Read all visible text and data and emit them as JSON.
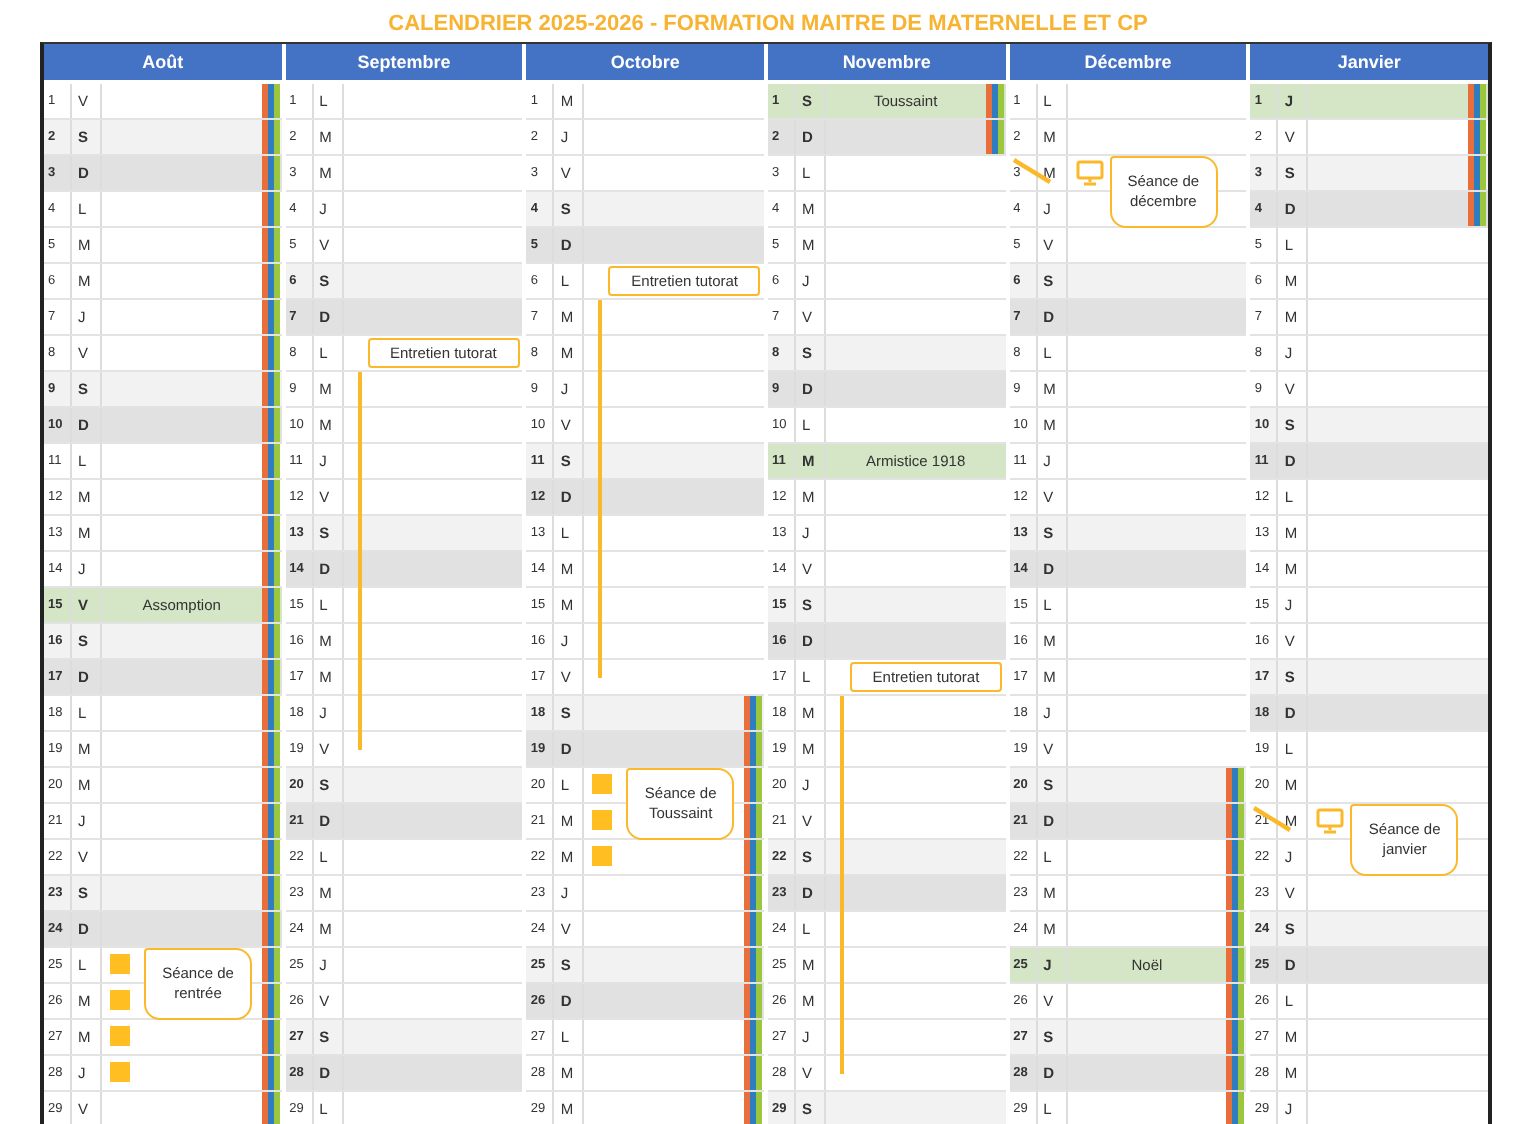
{
  "title": "CALENDRIER 2025-2026 - FORMATION MAITRE DE MATERNELLE ET CP",
  "months": [
    {
      "name": "Août",
      "days": [
        {
          "n": "1",
          "wd": "V",
          "kind": "weekday",
          "vacation": true,
          "line": false
        },
        {
          "n": "2",
          "wd": "S",
          "kind": "saturday",
          "vacation": true,
          "line": false
        },
        {
          "n": "3",
          "wd": "D",
          "kind": "sunday",
          "vacation": true,
          "line": false
        },
        {
          "n": "4",
          "wd": "L",
          "kind": "weekday",
          "vacation": true,
          "line": false
        },
        {
          "n": "5",
          "wd": "M",
          "kind": "weekday",
          "vacation": true,
          "line": false
        },
        {
          "n": "6",
          "wd": "M",
          "kind": "weekday",
          "vacation": true,
          "line": false
        },
        {
          "n": "7",
          "wd": "J",
          "kind": "weekday",
          "vacation": true,
          "line": false
        },
        {
          "n": "8",
          "wd": "V",
          "kind": "weekday",
          "vacation": true,
          "line": false
        },
        {
          "n": "9",
          "wd": "S",
          "kind": "saturday",
          "vacation": true,
          "line": false
        },
        {
          "n": "10",
          "wd": "D",
          "kind": "sunday",
          "vacation": true,
          "line": false
        },
        {
          "n": "11",
          "wd": "L",
          "kind": "weekday",
          "vacation": true,
          "line": false
        },
        {
          "n": "12",
          "wd": "M",
          "kind": "weekday",
          "vacation": true,
          "line": false
        },
        {
          "n": "13",
          "wd": "M",
          "kind": "weekday",
          "vacation": true,
          "line": false
        },
        {
          "n": "14",
          "wd": "J",
          "kind": "weekday",
          "vacation": true,
          "line": false
        },
        {
          "n": "15",
          "wd": "V",
          "kind": "holiday",
          "label": "Assomption",
          "vacation": true,
          "line": false
        },
        {
          "n": "16",
          "wd": "S",
          "kind": "saturday",
          "vacation": true,
          "line": false
        },
        {
          "n": "17",
          "wd": "D",
          "kind": "sunday",
          "vacation": true,
          "line": false
        },
        {
          "n": "18",
          "wd": "L",
          "kind": "weekday",
          "vacation": true,
          "line": false
        },
        {
          "n": "19",
          "wd": "M",
          "kind": "weekday",
          "vacation": true,
          "line": false
        },
        {
          "n": "20",
          "wd": "M",
          "kind": "weekday",
          "vacation": true,
          "line": false
        },
        {
          "n": "21",
          "wd": "J",
          "kind": "weekday",
          "vacation": true,
          "line": false
        },
        {
          "n": "22",
          "wd": "V",
          "kind": "weekday",
          "vacation": true,
          "line": false
        },
        {
          "n": "23",
          "wd": "S",
          "kind": "saturday",
          "vacation": true,
          "line": false
        },
        {
          "n": "24",
          "wd": "D",
          "kind": "sunday",
          "vacation": true,
          "line": false
        },
        {
          "n": "25",
          "wd": "L",
          "kind": "weekday",
          "vacation": true,
          "line": false,
          "marker": {
            "kind": "square"
          },
          "note": {
            "kind": "callout",
            "text": "Séance de rentrée"
          }
        },
        {
          "n": "26",
          "wd": "M",
          "kind": "weekday",
          "vacation": true,
          "line": false,
          "marker": {
            "kind": "square"
          }
        },
        {
          "n": "27",
          "wd": "M",
          "kind": "weekday",
          "vacation": true,
          "line": false,
          "marker": {
            "kind": "square"
          }
        },
        {
          "n": "28",
          "wd": "J",
          "kind": "weekday",
          "vacation": true,
          "line": false,
          "marker": {
            "kind": "square"
          }
        },
        {
          "n": "29",
          "wd": "V",
          "kind": "weekday",
          "vacation": true,
          "line": false
        }
      ]
    },
    {
      "name": "Septembre",
      "days": [
        {
          "n": "1",
          "wd": "L",
          "kind": "weekday",
          "vacation": false,
          "line": false
        },
        {
          "n": "2",
          "wd": "M",
          "kind": "weekday",
          "vacation": false,
          "line": false
        },
        {
          "n": "3",
          "wd": "M",
          "kind": "weekday",
          "vacation": false,
          "line": false
        },
        {
          "n": "4",
          "wd": "J",
          "kind": "weekday",
          "vacation": false,
          "line": false
        },
        {
          "n": "5",
          "wd": "V",
          "kind": "weekday",
          "vacation": false,
          "line": false
        },
        {
          "n": "6",
          "wd": "S",
          "kind": "saturday",
          "vacation": false,
          "line": false
        },
        {
          "n": "7",
          "wd": "D",
          "kind": "sunday",
          "vacation": false,
          "line": false
        },
        {
          "n": "8",
          "wd": "L",
          "kind": "weekday",
          "vacation": false,
          "line": false,
          "note": {
            "kind": "tag",
            "text": "Entretien tutorat"
          }
        },
        {
          "n": "9",
          "wd": "M",
          "kind": "weekday",
          "vacation": false,
          "line": true
        },
        {
          "n": "10",
          "wd": "M",
          "kind": "weekday",
          "vacation": false,
          "line": true
        },
        {
          "n": "11",
          "wd": "J",
          "kind": "weekday",
          "vacation": false,
          "line": true
        },
        {
          "n": "12",
          "wd": "V",
          "kind": "weekday",
          "vacation": false,
          "line": true
        },
        {
          "n": "13",
          "wd": "S",
          "kind": "saturday",
          "vacation": false,
          "line": true
        },
        {
          "n": "14",
          "wd": "D",
          "kind": "sunday",
          "vacation": false,
          "line": true
        },
        {
          "n": "15",
          "wd": "L",
          "kind": "weekday",
          "vacation": false,
          "line": true
        },
        {
          "n": "16",
          "wd": "M",
          "kind": "weekday",
          "vacation": false,
          "line": true
        },
        {
          "n": "17",
          "wd": "M",
          "kind": "weekday",
          "vacation": false,
          "line": true
        },
        {
          "n": "18",
          "wd": "J",
          "kind": "weekday",
          "vacation": false,
          "line": true
        },
        {
          "n": "19",
          "wd": "V",
          "kind": "weekday",
          "vacation": false,
          "line": true
        },
        {
          "n": "20",
          "wd": "S",
          "kind": "saturday",
          "vacation": false,
          "line": false
        },
        {
          "n": "21",
          "wd": "D",
          "kind": "sunday",
          "vacation": false,
          "line": false
        },
        {
          "n": "22",
          "wd": "L",
          "kind": "weekday",
          "vacation": false,
          "line": false
        },
        {
          "n": "23",
          "wd": "M",
          "kind": "weekday",
          "vacation": false,
          "line": false
        },
        {
          "n": "24",
          "wd": "M",
          "kind": "weekday",
          "vacation": false,
          "line": false
        },
        {
          "n": "25",
          "wd": "J",
          "kind": "weekday",
          "vacation": false,
          "line": false
        },
        {
          "n": "26",
          "wd": "V",
          "kind": "weekday",
          "vacation": false,
          "line": false
        },
        {
          "n": "27",
          "wd": "S",
          "kind": "saturday",
          "vacation": false,
          "line": false
        },
        {
          "n": "28",
          "wd": "D",
          "kind": "sunday",
          "vacation": false,
          "line": false
        },
        {
          "n": "29",
          "wd": "L",
          "kind": "weekday",
          "vacation": false,
          "line": false
        }
      ]
    },
    {
      "name": "Octobre",
      "days": [
        {
          "n": "1",
          "wd": "M",
          "kind": "weekday",
          "vacation": false,
          "line": false
        },
        {
          "n": "2",
          "wd": "J",
          "kind": "weekday",
          "vacation": false,
          "line": false
        },
        {
          "n": "3",
          "wd": "V",
          "kind": "weekday",
          "vacation": false,
          "line": false
        },
        {
          "n": "4",
          "wd": "S",
          "kind": "saturday",
          "vacation": false,
          "line": false
        },
        {
          "n": "5",
          "wd": "D",
          "kind": "sunday",
          "vacation": false,
          "line": false
        },
        {
          "n": "6",
          "wd": "L",
          "kind": "weekday",
          "vacation": false,
          "line": false,
          "note": {
            "kind": "tag",
            "text": "Entretien tutorat"
          }
        },
        {
          "n": "7",
          "wd": "M",
          "kind": "weekday",
          "vacation": false,
          "line": true
        },
        {
          "n": "8",
          "wd": "M",
          "kind": "weekday",
          "vacation": false,
          "line": true
        },
        {
          "n": "9",
          "wd": "J",
          "kind": "weekday",
          "vacation": false,
          "line": true
        },
        {
          "n": "10",
          "wd": "V",
          "kind": "weekday",
          "vacation": false,
          "line": true
        },
        {
          "n": "11",
          "wd": "S",
          "kind": "saturday",
          "vacation": false,
          "line": true
        },
        {
          "n": "12",
          "wd": "D",
          "kind": "sunday",
          "vacation": false,
          "line": true
        },
        {
          "n": "13",
          "wd": "L",
          "kind": "weekday",
          "vacation": false,
          "line": true
        },
        {
          "n": "14",
          "wd": "M",
          "kind": "weekday",
          "vacation": false,
          "line": true
        },
        {
          "n": "15",
          "wd": "M",
          "kind": "weekday",
          "vacation": false,
          "line": true
        },
        {
          "n": "16",
          "wd": "J",
          "kind": "weekday",
          "vacation": false,
          "line": true
        },
        {
          "n": "17",
          "wd": "V",
          "kind": "weekday",
          "vacation": false,
          "line": true
        },
        {
          "n": "18",
          "wd": "S",
          "kind": "saturday",
          "vacation": true,
          "line": false
        },
        {
          "n": "19",
          "wd": "D",
          "kind": "sunday",
          "vacation": true,
          "line": false
        },
        {
          "n": "20",
          "wd": "L",
          "kind": "weekday",
          "vacation": true,
          "line": false,
          "marker": {
            "kind": "square"
          },
          "note": {
            "kind": "callout",
            "text": "Séance de Toussaint"
          }
        },
        {
          "n": "21",
          "wd": "M",
          "kind": "weekday",
          "vacation": true,
          "line": false,
          "marker": {
            "kind": "square"
          }
        },
        {
          "n": "22",
          "wd": "M",
          "kind": "weekday",
          "vacation": true,
          "line": false,
          "marker": {
            "kind": "square"
          }
        },
        {
          "n": "23",
          "wd": "J",
          "kind": "weekday",
          "vacation": true,
          "line": false
        },
        {
          "n": "24",
          "wd": "V",
          "kind": "weekday",
          "vacation": true,
          "line": false
        },
        {
          "n": "25",
          "wd": "S",
          "kind": "saturday",
          "vacation": true,
          "line": false
        },
        {
          "n": "26",
          "wd": "D",
          "kind": "sunday",
          "vacation": true,
          "line": false
        },
        {
          "n": "27",
          "wd": "L",
          "kind": "weekday",
          "vacation": true,
          "line": false
        },
        {
          "n": "28",
          "wd": "M",
          "kind": "weekday",
          "vacation": true,
          "line": false
        },
        {
          "n": "29",
          "wd": "M",
          "kind": "weekday",
          "vacation": true,
          "line": false
        }
      ]
    },
    {
      "name": "Novembre",
      "days": [
        {
          "n": "1",
          "wd": "S",
          "kind": "holiday",
          "label": "Toussaint",
          "vacation": true,
          "line": false
        },
        {
          "n": "2",
          "wd": "D",
          "kind": "sunday",
          "vacation": true,
          "line": false
        },
        {
          "n": "3",
          "wd": "L",
          "kind": "weekday",
          "vacation": false,
          "line": false
        },
        {
          "n": "4",
          "wd": "M",
          "kind": "weekday",
          "vacation": false,
          "line": false
        },
        {
          "n": "5",
          "wd": "M",
          "kind": "weekday",
          "vacation": false,
          "line": false
        },
        {
          "n": "6",
          "wd": "J",
          "kind": "weekday",
          "vacation": false,
          "line": false
        },
        {
          "n": "7",
          "wd": "V",
          "kind": "weekday",
          "vacation": false,
          "line": false
        },
        {
          "n": "8",
          "wd": "S",
          "kind": "saturday",
          "vacation": false,
          "line": false
        },
        {
          "n": "9",
          "wd": "D",
          "kind": "sunday",
          "vacation": false,
          "line": false
        },
        {
          "n": "10",
          "wd": "L",
          "kind": "weekday",
          "vacation": false,
          "line": false
        },
        {
          "n": "11",
          "wd": "M",
          "kind": "holiday",
          "label": "Armistice 1918",
          "vacation": false,
          "line": false
        },
        {
          "n": "12",
          "wd": "M",
          "kind": "weekday",
          "vacation": false,
          "line": false
        },
        {
          "n": "13",
          "wd": "J",
          "kind": "weekday",
          "vacation": false,
          "line": false
        },
        {
          "n": "14",
          "wd": "V",
          "kind": "weekday",
          "vacation": false,
          "line": false
        },
        {
          "n": "15",
          "wd": "S",
          "kind": "saturday",
          "vacation": false,
          "line": false
        },
        {
          "n": "16",
          "wd": "D",
          "kind": "sunday",
          "vacation": false,
          "line": false
        },
        {
          "n": "17",
          "wd": "L",
          "kind": "weekday",
          "vacation": false,
          "line": false,
          "note": {
            "kind": "tag",
            "text": "Entretien tutorat"
          }
        },
        {
          "n": "18",
          "wd": "M",
          "kind": "weekday",
          "vacation": false,
          "line": true
        },
        {
          "n": "19",
          "wd": "M",
          "kind": "weekday",
          "vacation": false,
          "line": true
        },
        {
          "n": "20",
          "wd": "J",
          "kind": "weekday",
          "vacation": false,
          "line": true
        },
        {
          "n": "21",
          "wd": "V",
          "kind": "weekday",
          "vacation": false,
          "line": true
        },
        {
          "n": "22",
          "wd": "S",
          "kind": "saturday",
          "vacation": false,
          "line": true
        },
        {
          "n": "23",
          "wd": "D",
          "kind": "sunday",
          "vacation": false,
          "line": true
        },
        {
          "n": "24",
          "wd": "L",
          "kind": "weekday",
          "vacation": false,
          "line": true
        },
        {
          "n": "25",
          "wd": "M",
          "kind": "weekday",
          "vacation": false,
          "line": true
        },
        {
          "n": "26",
          "wd": "M",
          "kind": "weekday",
          "vacation": false,
          "line": true
        },
        {
          "n": "27",
          "wd": "J",
          "kind": "weekday",
          "vacation": false,
          "line": true
        },
        {
          "n": "28",
          "wd": "V",
          "kind": "weekday",
          "vacation": false,
          "line": true
        },
        {
          "n": "29",
          "wd": "S",
          "kind": "saturday",
          "vacation": false,
          "line": false
        }
      ]
    },
    {
      "name": "Décembre",
      "days": [
        {
          "n": "1",
          "wd": "L",
          "kind": "weekday",
          "vacation": false,
          "line": false
        },
        {
          "n": "2",
          "wd": "M",
          "kind": "weekday",
          "vacation": false,
          "line": false
        },
        {
          "n": "3",
          "wd": "M",
          "kind": "weekday",
          "vacation": false,
          "line": false,
          "marker": {
            "kind": "screen"
          },
          "note": {
            "kind": "callout",
            "text": "Séance de décembre"
          }
        },
        {
          "n": "4",
          "wd": "J",
          "kind": "weekday",
          "vacation": false,
          "line": false
        },
        {
          "n": "5",
          "wd": "V",
          "kind": "weekday",
          "vacation": false,
          "line": false
        },
        {
          "n": "6",
          "wd": "S",
          "kind": "saturday",
          "vacation": false,
          "line": false
        },
        {
          "n": "7",
          "wd": "D",
          "kind": "sunday",
          "vacation": false,
          "line": false
        },
        {
          "n": "8",
          "wd": "L",
          "kind": "weekday",
          "vacation": false,
          "line": false
        },
        {
          "n": "9",
          "wd": "M",
          "kind": "weekday",
          "vacation": false,
          "line": false
        },
        {
          "n": "10",
          "wd": "M",
          "kind": "weekday",
          "vacation": false,
          "line": false
        },
        {
          "n": "11",
          "wd": "J",
          "kind": "weekday",
          "vacation": false,
          "line": false
        },
        {
          "n": "12",
          "wd": "V",
          "kind": "weekday",
          "vacation": false,
          "line": false
        },
        {
          "n": "13",
          "wd": "S",
          "kind": "saturday",
          "vacation": false,
          "line": false
        },
        {
          "n": "14",
          "wd": "D",
          "kind": "sunday",
          "vacation": false,
          "line": false
        },
        {
          "n": "15",
          "wd": "L",
          "kind": "weekday",
          "vacation": false,
          "line": false
        },
        {
          "n": "16",
          "wd": "M",
          "kind": "weekday",
          "vacation": false,
          "line": false
        },
        {
          "n": "17",
          "wd": "M",
          "kind": "weekday",
          "vacation": false,
          "line": false
        },
        {
          "n": "18",
          "wd": "J",
          "kind": "weekday",
          "vacation": false,
          "line": false
        },
        {
          "n": "19",
          "wd": "V",
          "kind": "weekday",
          "vacation": false,
          "line": false
        },
        {
          "n": "20",
          "wd": "S",
          "kind": "saturday",
          "vacation": true,
          "line": false
        },
        {
          "n": "21",
          "wd": "D",
          "kind": "sunday",
          "vacation": true,
          "line": false
        },
        {
          "n": "22",
          "wd": "L",
          "kind": "weekday",
          "vacation": true,
          "line": false
        },
        {
          "n": "23",
          "wd": "M",
          "kind": "weekday",
          "vacation": true,
          "line": false
        },
        {
          "n": "24",
          "wd": "M",
          "kind": "weekday",
          "vacation": true,
          "line": false
        },
        {
          "n": "25",
          "wd": "J",
          "kind": "holiday",
          "label": "Noël",
          "vacation": true,
          "line": false
        },
        {
          "n": "26",
          "wd": "V",
          "kind": "weekday",
          "vacation": true,
          "line": false
        },
        {
          "n": "27",
          "wd": "S",
          "kind": "saturday",
          "vacation": true,
          "line": false
        },
        {
          "n": "28",
          "wd": "D",
          "kind": "sunday",
          "vacation": true,
          "line": false
        },
        {
          "n": "29",
          "wd": "L",
          "kind": "weekday",
          "vacation": true,
          "line": false
        }
      ]
    },
    {
      "name": "Janvier",
      "days": [
        {
          "n": "1",
          "wd": "J",
          "kind": "holiday",
          "vacation": true,
          "line": false
        },
        {
          "n": "2",
          "wd": "V",
          "kind": "weekday",
          "vacation": true,
          "line": false
        },
        {
          "n": "3",
          "wd": "S",
          "kind": "saturday",
          "vacation": true,
          "line": false
        },
        {
          "n": "4",
          "wd": "D",
          "kind": "sunday",
          "vacation": true,
          "line": false
        },
        {
          "n": "5",
          "wd": "L",
          "kind": "weekday",
          "vacation": false,
          "line": false
        },
        {
          "n": "6",
          "wd": "M",
          "kind": "weekday",
          "vacation": false,
          "line": false
        },
        {
          "n": "7",
          "wd": "M",
          "kind": "weekday",
          "vacation": false,
          "line": false
        },
        {
          "n": "8",
          "wd": "J",
          "kind": "weekday",
          "vacation": false,
          "line": false
        },
        {
          "n": "9",
          "wd": "V",
          "kind": "weekday",
          "vacation": false,
          "line": false
        },
        {
          "n": "10",
          "wd": "S",
          "kind": "saturday",
          "vacation": false,
          "line": false
        },
        {
          "n": "11",
          "wd": "D",
          "kind": "sunday",
          "vacation": false,
          "line": false
        },
        {
          "n": "12",
          "wd": "L",
          "kind": "weekday",
          "vacation": false,
          "line": false
        },
        {
          "n": "13",
          "wd": "M",
          "kind": "weekday",
          "vacation": false,
          "line": false
        },
        {
          "n": "14",
          "wd": "M",
          "kind": "weekday",
          "vacation": false,
          "line": false
        },
        {
          "n": "15",
          "wd": "J",
          "kind": "weekday",
          "vacation": false,
          "line": false
        },
        {
          "n": "16",
          "wd": "V",
          "kind": "weekday",
          "vacation": false,
          "line": false
        },
        {
          "n": "17",
          "wd": "S",
          "kind": "saturday",
          "vacation": false,
          "line": false
        },
        {
          "n": "18",
          "wd": "D",
          "kind": "sunday",
          "vacation": false,
          "line": false
        },
        {
          "n": "19",
          "wd": "L",
          "kind": "weekday",
          "vacation": false,
          "line": false
        },
        {
          "n": "20",
          "wd": "M",
          "kind": "weekday",
          "vacation": false,
          "line": false
        },
        {
          "n": "21",
          "wd": "M",
          "kind": "weekday",
          "vacation": false,
          "line": false,
          "marker": {
            "kind": "screen"
          },
          "note": {
            "kind": "callout",
            "text": "Séance de janvier"
          }
        },
        {
          "n": "22",
          "wd": "J",
          "kind": "weekday",
          "vacation": false,
          "line": false
        },
        {
          "n": "23",
          "wd": "V",
          "kind": "weekday",
          "vacation": false,
          "line": false
        },
        {
          "n": "24",
          "wd": "S",
          "kind": "saturday",
          "vacation": false,
          "line": false
        },
        {
          "n": "25",
          "wd": "D",
          "kind": "sunday",
          "vacation": false,
          "line": false
        },
        {
          "n": "26",
          "wd": "L",
          "kind": "weekday",
          "vacation": false,
          "line": false
        },
        {
          "n": "27",
          "wd": "M",
          "kind": "weekday",
          "vacation": false,
          "line": false
        },
        {
          "n": "28",
          "wd": "M",
          "kind": "weekday",
          "vacation": false,
          "line": false
        },
        {
          "n": "29",
          "wd": "J",
          "kind": "weekday",
          "vacation": false,
          "line": false
        }
      ]
    }
  ]
}
